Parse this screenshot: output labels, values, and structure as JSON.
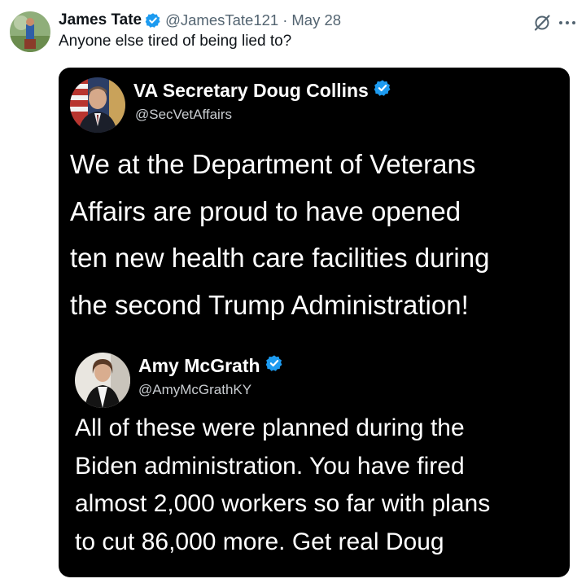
{
  "tweet": {
    "author_name": "James Tate",
    "handle": "@JamesTate121",
    "separator": "·",
    "date": "May 28",
    "text": "Anyone else tired of being lied to?"
  },
  "icons": {
    "verified": "verified-badge-icon",
    "grok": "grok-icon",
    "more": "more-options-icon"
  },
  "colors": {
    "verified_blue": "#1d9bf0",
    "media_background": "#000000",
    "text_primary": "#0f1419",
    "text_secondary": "#536471"
  },
  "image": {
    "post1": {
      "name": "VA Secretary Doug Collins",
      "handle": "@SecVetAffairs",
      "lines": [
        "We at the Department of Veterans",
        "Affairs are proud to have opened",
        "ten new health care facilities during",
        "the second Trump Administration!"
      ]
    },
    "post2": {
      "name": "Amy McGrath",
      "handle": "@AmyMcGrathKY",
      "lines": [
        "All of these were planned during the",
        "Biden administration. You have fired",
        "almost 2,000 workers so far with plans",
        "to cut 86,000 more. Get real Doug"
      ]
    }
  }
}
